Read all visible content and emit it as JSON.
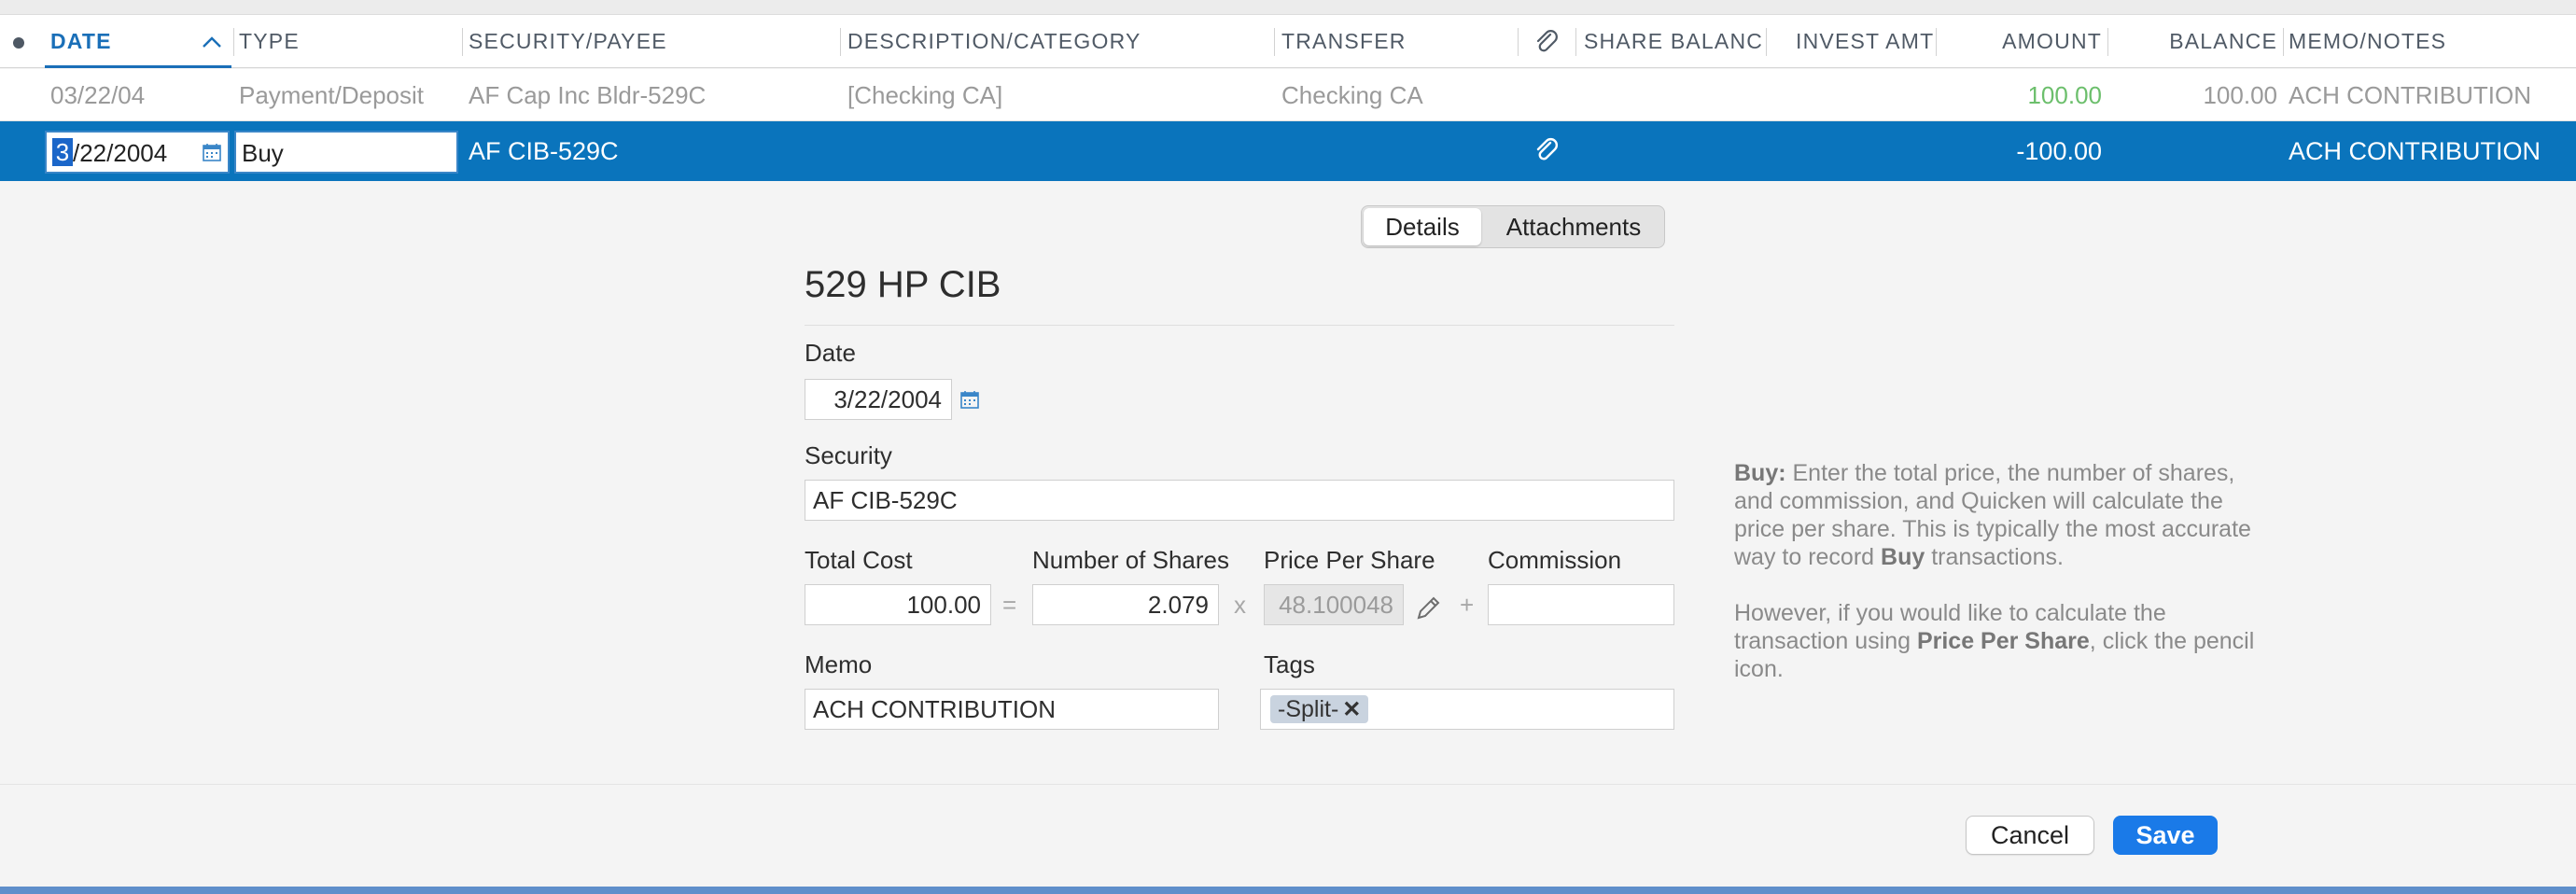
{
  "columns": {
    "date": "DATE",
    "type": "TYPE",
    "security_payee": "SECURITY/PAYEE",
    "description_category": "DESCRIPTION/CATEGORY",
    "transfer": "TRANSFER",
    "share_balance": "SHARE BALANCE",
    "invest_amt": "INVEST AMT",
    "amount": "AMOUNT",
    "balance": "BALANCE",
    "memo_notes": "MEMO/NOTES"
  },
  "prev_row": {
    "date": "03/22/04",
    "type": "Payment/Deposit",
    "payee": "AF Cap Inc Bldr-529C",
    "category": "[Checking CA]",
    "transfer": "Checking CA",
    "amount": "100.00",
    "balance": "100.00",
    "memo": "ACH CONTRIBUTION"
  },
  "selected_row": {
    "date_first_char": "3",
    "date_rest": "/22/2004",
    "type": "Buy",
    "payee": "AF CIB-529C",
    "amount": "-100.00",
    "memo": "ACH CONTRIBUTION"
  },
  "detail": {
    "tabs": {
      "details": "Details",
      "attachments": "Attachments"
    },
    "account_title": "529 HP CIB",
    "date_label": "Date",
    "date_value": "3/22/2004",
    "security_label": "Security",
    "security_value": "AF CIB-529C",
    "total_cost_label": "Total Cost",
    "total_cost_value": "100.00",
    "num_shares_label": "Number of Shares",
    "num_shares_value": "2.079",
    "price_label": "Price Per Share",
    "price_value": "48.100048",
    "commission_label": "Commission",
    "commission_value": "",
    "op_equals": "=",
    "op_times": "x",
    "op_plus": "+",
    "memo_label": "Memo",
    "memo_value": "ACH CONTRIBUTION",
    "tags_label": "Tags",
    "tag_chip": "-Split-",
    "tag_remove": "✕"
  },
  "help": {
    "p1_bold": "Buy:",
    "p1_text": " Enter the total price, the number of shares, and commission, and Quicken will calculate the price per share. This is typically the most accurate way to record ",
    "p1_bold2": "Buy",
    "p1_end": " transactions.",
    "p2_text": "However, if you would like to calculate the transaction using ",
    "p2_bold": "Price Per Share",
    "p2_end": ", click the pencil icon."
  },
  "buttons": {
    "cancel": "Cancel",
    "save": "Save"
  },
  "colors": {
    "selected_row": "#0a74bc",
    "positive_amount": "#6cbf6c",
    "save_button": "#1a7ae8",
    "date_header": "#1a6fb8"
  }
}
